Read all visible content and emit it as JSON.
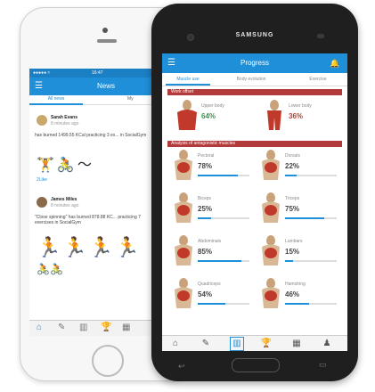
{
  "iphone": {
    "status": {
      "carrier": "●●●●● ≈",
      "time": "16:47"
    },
    "header_title": "News",
    "tabs": [
      "All news",
      "My"
    ],
    "feed": [
      {
        "name": "Sarah Evans",
        "time": "8 minutes ago",
        "text": "has burned 1499.55 KCal practicing 3 ex... in SocialGym",
        "likes": "2Like"
      },
      {
        "name": "James Miles",
        "time": "8 minutes ago",
        "text": "\"Close spinning\" has burned 878.88 KC... practicing 7 exercises in SocialGym"
      }
    ],
    "nav": [
      "⌂",
      "✎",
      "▥",
      "🏆",
      "▦"
    ]
  },
  "samsung": {
    "brand": "SAMSUNG",
    "header_title": "Progress",
    "tabs": [
      "Muscle use",
      "Body evolution",
      "Exercise"
    ],
    "section_work": "Work offset",
    "upper": {
      "label": "Upper body",
      "value": "64%",
      "percent": 64,
      "color": "#2e9b48"
    },
    "lower": {
      "label": "Lower body",
      "value": "36%",
      "percent": 36,
      "color": "#c0392b"
    },
    "section_antagonist": "Analysis of antagonistic muscles",
    "muscles": [
      {
        "label": "Pectoral",
        "value": "78%",
        "percent": 78
      },
      {
        "label": "Dorsals",
        "value": "22%",
        "percent": 22
      },
      {
        "label": "Biceps",
        "value": "25%",
        "percent": 25
      },
      {
        "label": "Triceps",
        "value": "75%",
        "percent": 75
      },
      {
        "label": "Abdominals",
        "value": "85%",
        "percent": 85
      },
      {
        "label": "Lumbars",
        "value": "15%",
        "percent": 15
      },
      {
        "label": "Quadriceps",
        "value": "54%",
        "percent": 54
      },
      {
        "label": "Hamstring",
        "value": "46%",
        "percent": 46
      }
    ],
    "nav": [
      "⌂",
      "✎",
      "▥",
      "🏆",
      "▦",
      "♟"
    ]
  },
  "colors": {
    "accent": "#1e8fd8",
    "section": "#b23a3a"
  }
}
